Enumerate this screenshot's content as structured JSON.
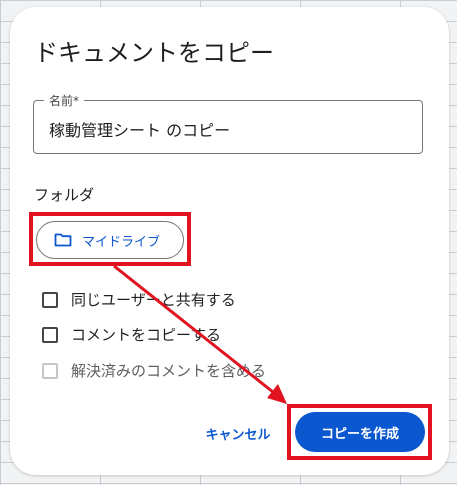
{
  "dialog": {
    "title": "ドキュメントをコピー",
    "name_field": {
      "label": "名前*",
      "value": "稼動管理シート のコピー"
    },
    "folder": {
      "label": "フォルダ",
      "chip_label": "マイドライブ",
      "chip_icon": "folder-icon"
    },
    "options": [
      {
        "label": "同じユーザーと共有する",
        "checked": false,
        "enabled": true
      },
      {
        "label": "コメントをコピーする",
        "checked": false,
        "enabled": true
      },
      {
        "label": "解決済みのコメントを含める",
        "checked": false,
        "enabled": false
      }
    ],
    "buttons": {
      "cancel": "キャンセル",
      "confirm": "コピーを作成"
    }
  },
  "colors": {
    "accent": "#0b57d0",
    "annotation": "#e0131f"
  }
}
